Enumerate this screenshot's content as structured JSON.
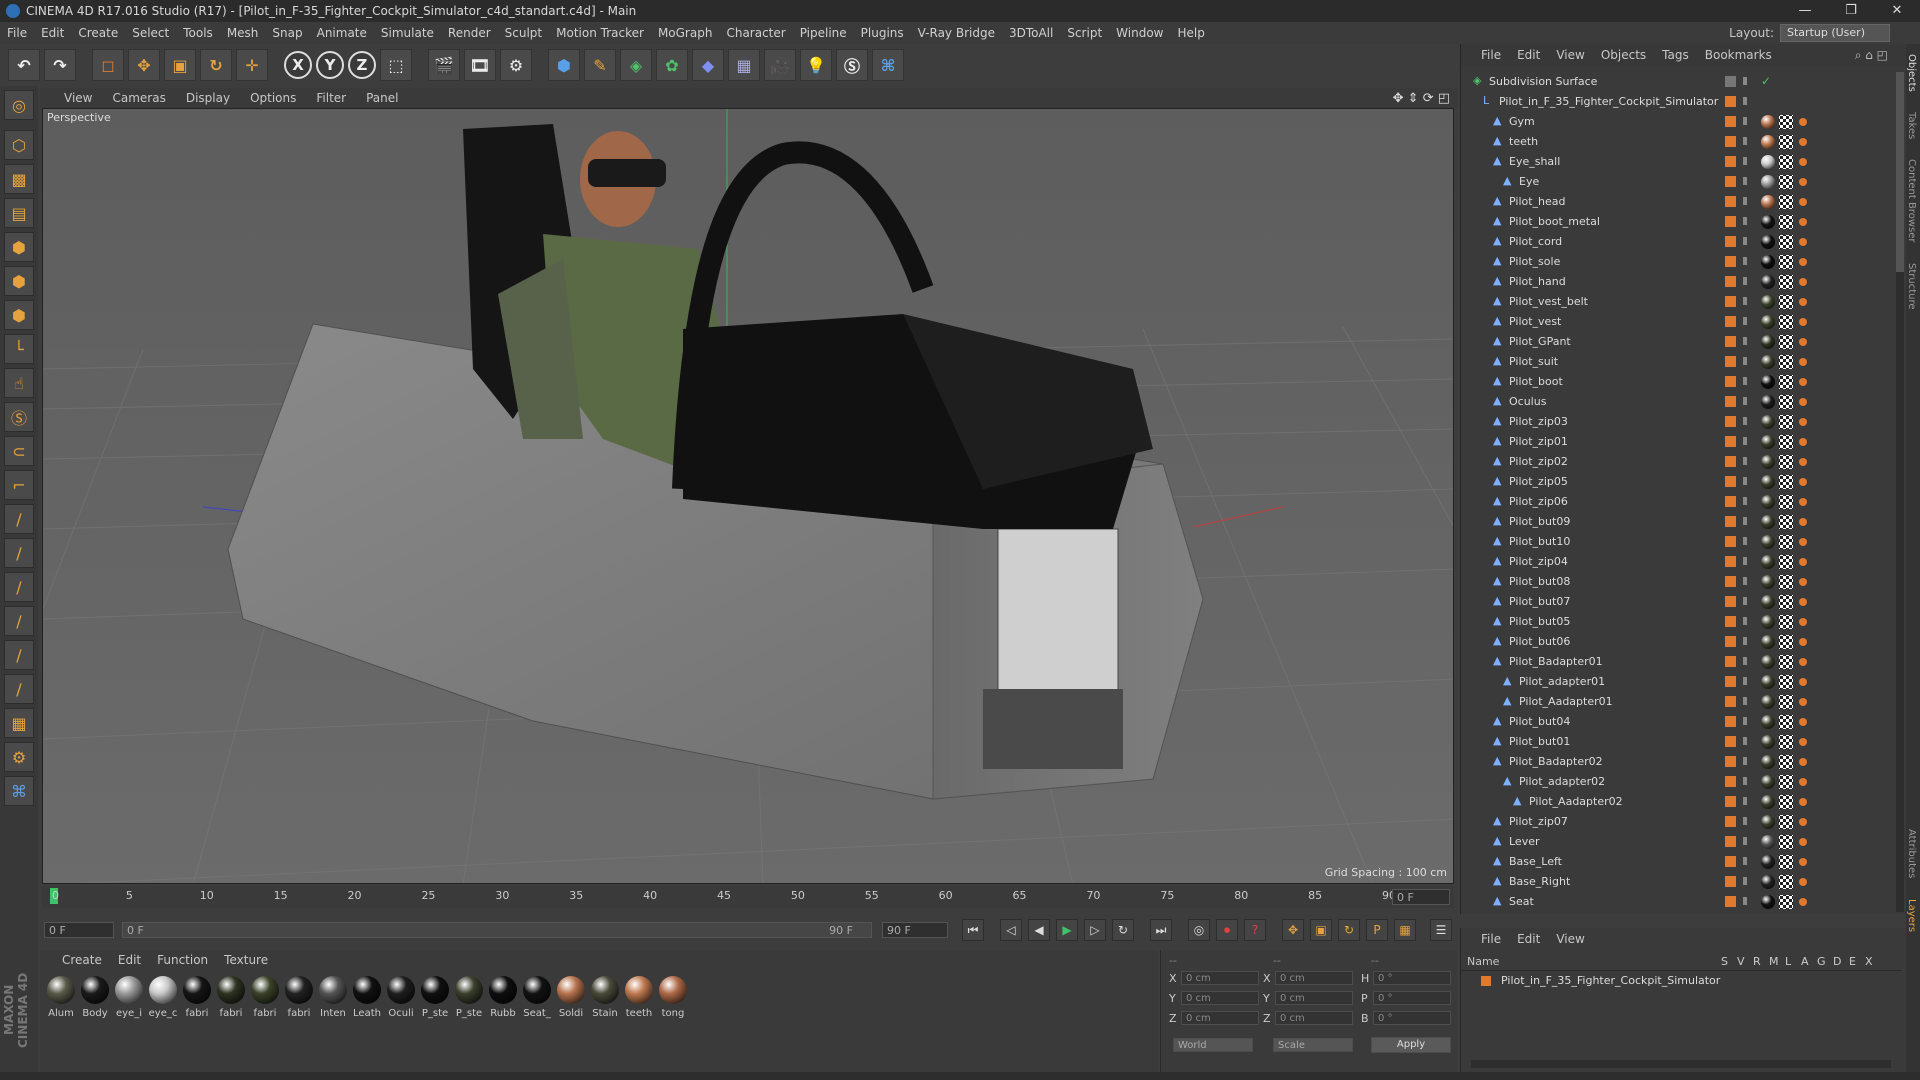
{
  "window": {
    "title": "CINEMA 4D R17.016 Studio (R17) - [Pilot_in_F-35_Fighter_Cockpit_Simulator_c4d_standart.c4d] - Main",
    "controls": [
      "—",
      "❐",
      "✕"
    ]
  },
  "menubar": {
    "items": [
      "File",
      "Edit",
      "Create",
      "Select",
      "Tools",
      "Mesh",
      "Snap",
      "Animate",
      "Simulate",
      "Render",
      "Sculpt",
      "Motion Tracker",
      "MoGraph",
      "Character",
      "Pipeline",
      "Plugins",
      "V-Ray Bridge",
      "3DToAll",
      "Script",
      "Window",
      "Help"
    ],
    "layout_label": "Layout:",
    "layout_value": "Startup (User)"
  },
  "toolbar": {
    "axis_x": "X",
    "axis_y": "Y",
    "axis_z": "Z"
  },
  "viewport": {
    "menu": [
      "View",
      "Cameras",
      "Display",
      "Options",
      "Filter",
      "Panel"
    ],
    "label": "Perspective",
    "grid_spacing": "Grid Spacing : 100 cm"
  },
  "timeline": {
    "ticks": [
      "0",
      "5",
      "10",
      "15",
      "20",
      "25",
      "30",
      "35",
      "40",
      "45",
      "50",
      "55",
      "60",
      "65",
      "70",
      "75",
      "80",
      "85",
      "90"
    ],
    "current_frame": "0 F",
    "start_field": "0 F",
    "range_start": "0 F",
    "range_end": "90 F",
    "end_field": "90 F"
  },
  "materials": {
    "menu": [
      "Create",
      "Edit",
      "Function",
      "Texture"
    ],
    "items": [
      {
        "label": "Alum",
        "color": "#5a5a4a"
      },
      {
        "label": "Body",
        "color": "#1a1a1a"
      },
      {
        "label": "eye_i",
        "color": "#9a9a9a"
      },
      {
        "label": "eye_c",
        "color": "#c8c8c8"
      },
      {
        "label": "fabri",
        "color": "#151515"
      },
      {
        "label": "fabri",
        "color": "#2e3322"
      },
      {
        "label": "fabri",
        "color": "#3a4228"
      },
      {
        "label": "fabri",
        "color": "#222222"
      },
      {
        "label": "Inten",
        "color": "#555555"
      },
      {
        "label": "Leath",
        "color": "#111111"
      },
      {
        "label": "Oculi",
        "color": "#1e1e1e"
      },
      {
        "label": "P_ste",
        "color": "#101010"
      },
      {
        "label": "P_ste",
        "color": "#3b3f2c"
      },
      {
        "label": "Rubb",
        "color": "#0e0e0e"
      },
      {
        "label": "Seat_",
        "color": "#121212"
      },
      {
        "label": "Soldi",
        "color": "#b8744e"
      },
      {
        "label": "Stain",
        "color": "#4a4a3a"
      },
      {
        "label": "teeth",
        "color": "#c07a50"
      },
      {
        "label": "tong",
        "color": "#b06a48"
      }
    ]
  },
  "coords": {
    "header": [
      "--",
      "--",
      "--"
    ],
    "rows": [
      {
        "a": "X",
        "av": "0 cm",
        "b": "X",
        "bv": "0 cm",
        "c": "H",
        "cv": "0 °"
      },
      {
        "a": "Y",
        "av": "0 cm",
        "b": "Y",
        "bv": "0 cm",
        "c": "P",
        "cv": "0 °"
      },
      {
        "a": "Z",
        "av": "0 cm",
        "b": "Z",
        "bv": "0 cm",
        "c": "B",
        "cv": "0 °"
      }
    ],
    "world": "World",
    "scale": "Scale",
    "apply": "Apply"
  },
  "objects": {
    "menu": [
      "File",
      "Edit",
      "View",
      "Objects",
      "Tags",
      "Bookmarks"
    ],
    "rows": [
      {
        "name": "Subdivision Surface",
        "indent": 0,
        "mat": ""
      },
      {
        "name": "Pilot_in_F_35_Fighter_Cockpit_Simulator",
        "indent": 1,
        "mat": ""
      },
      {
        "name": "Gym",
        "indent": 2,
        "mat": "#b8744e"
      },
      {
        "name": "teeth",
        "indent": 2,
        "mat": "#c07a50"
      },
      {
        "name": "Eye_shall",
        "indent": 2,
        "mat": "#c8c8c8"
      },
      {
        "name": "Eye",
        "indent": 3,
        "mat": "#9a9a9a"
      },
      {
        "name": "Pilot_head",
        "indent": 2,
        "mat": "#b8744e"
      },
      {
        "name": "Pilot_boot_metal",
        "indent": 2,
        "mat": "#151515"
      },
      {
        "name": "Pilot_cord",
        "indent": 2,
        "mat": "#111111"
      },
      {
        "name": "Pilot_sole",
        "indent": 2,
        "mat": "#0e0e0e"
      },
      {
        "name": "Pilot_hand",
        "indent": 2,
        "mat": "#222222"
      },
      {
        "name": "Pilot_vest_belt",
        "indent": 2,
        "mat": "#3a4228"
      },
      {
        "name": "Pilot_vest",
        "indent": 2,
        "mat": "#3a4228"
      },
      {
        "name": "Pilot_GPant",
        "indent": 2,
        "mat": "#2e3322"
      },
      {
        "name": "Pilot_suit",
        "indent": 2,
        "mat": "#3b3f2c"
      },
      {
        "name": "Pilot_boot",
        "indent": 2,
        "mat": "#101010"
      },
      {
        "name": "Oculus",
        "indent": 2,
        "mat": "#1e1e1e"
      },
      {
        "name": "Pilot_zip03",
        "indent": 2,
        "mat": "#3b3f2c"
      },
      {
        "name": "Pilot_zip01",
        "indent": 2,
        "mat": "#3b3f2c"
      },
      {
        "name": "Pilot_zip02",
        "indent": 2,
        "mat": "#3b3f2c"
      },
      {
        "name": "Pilot_zip05",
        "indent": 2,
        "mat": "#3b3f2c"
      },
      {
        "name": "Pilot_zip06",
        "indent": 2,
        "mat": "#3b3f2c"
      },
      {
        "name": "Pilot_but09",
        "indent": 2,
        "mat": "#3b3f2c"
      },
      {
        "name": "Pilot_but10",
        "indent": 2,
        "mat": "#3b3f2c"
      },
      {
        "name": "Pilot_zip04",
        "indent": 2,
        "mat": "#3b3f2c"
      },
      {
        "name": "Pilot_but08",
        "indent": 2,
        "mat": "#3b3f2c"
      },
      {
        "name": "Pilot_but07",
        "indent": 2,
        "mat": "#3b3f2c"
      },
      {
        "name": "Pilot_but05",
        "indent": 2,
        "mat": "#3b3f2c"
      },
      {
        "name": "Pilot_but06",
        "indent": 2,
        "mat": "#3b3f2c"
      },
      {
        "name": "Pilot_Badapter01",
        "indent": 2,
        "mat": "#3b3f2c"
      },
      {
        "name": "Pilot_adapter01",
        "indent": 3,
        "mat": "#3b3f2c"
      },
      {
        "name": "Pilot_Aadapter01",
        "indent": 3,
        "mat": "#3b3f2c"
      },
      {
        "name": "Pilot_but04",
        "indent": 2,
        "mat": "#3b3f2c"
      },
      {
        "name": "Pilot_but01",
        "indent": 2,
        "mat": "#3b3f2c"
      },
      {
        "name": "Pilot_Badapter02",
        "indent": 2,
        "mat": "#3b3f2c"
      },
      {
        "name": "Pilot_adapter02",
        "indent": 3,
        "mat": "#3b3f2c"
      },
      {
        "name": "Pilot_Aadapter02",
        "indent": 4,
        "mat": "#3b3f2c"
      },
      {
        "name": "Pilot_zip07",
        "indent": 2,
        "mat": "#3b3f2c"
      },
      {
        "name": "Lever",
        "indent": 2,
        "mat": "#555555"
      },
      {
        "name": "Base_Left",
        "indent": 2,
        "mat": "#222222"
      },
      {
        "name": "Base_Right",
        "indent": 2,
        "mat": "#222222"
      },
      {
        "name": "Seat",
        "indent": 2,
        "mat": "#121212"
      }
    ]
  },
  "layers": {
    "menu": [
      "File",
      "Edit",
      "View"
    ],
    "header_name": "Name",
    "header_cols": [
      "S",
      "V",
      "R",
      "M",
      "L",
      "A",
      "G",
      "D",
      "E",
      "X"
    ],
    "row_name": "Pilot_in_F_35_Fighter_Cockpit_Simulator"
  },
  "sidetabs": [
    "Objects",
    "Takes",
    "Content Browser",
    "Structure"
  ],
  "sidetabs_bottom": [
    "Attributes",
    "Layers"
  ],
  "branding": "MAXON CINEMA 4D"
}
